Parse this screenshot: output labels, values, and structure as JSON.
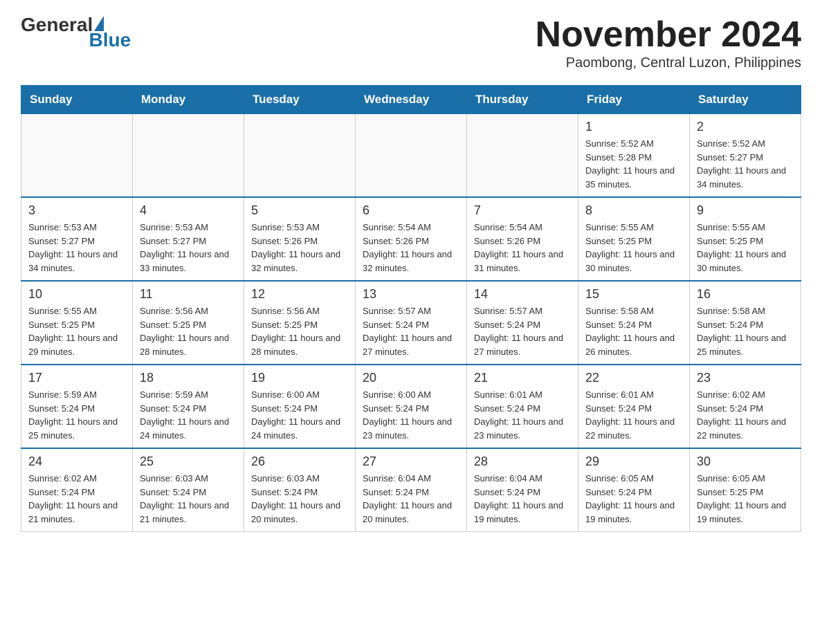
{
  "header": {
    "logo": {
      "general": "General",
      "blue": "Blue"
    },
    "title": "November 2024",
    "location": "Paombong, Central Luzon, Philippines"
  },
  "days_of_week": [
    "Sunday",
    "Monday",
    "Tuesday",
    "Wednesday",
    "Thursday",
    "Friday",
    "Saturday"
  ],
  "weeks": [
    [
      {
        "day": "",
        "sunrise": "",
        "sunset": "",
        "daylight": ""
      },
      {
        "day": "",
        "sunrise": "",
        "sunset": "",
        "daylight": ""
      },
      {
        "day": "",
        "sunrise": "",
        "sunset": "",
        "daylight": ""
      },
      {
        "day": "",
        "sunrise": "",
        "sunset": "",
        "daylight": ""
      },
      {
        "day": "",
        "sunrise": "",
        "sunset": "",
        "daylight": ""
      },
      {
        "day": "1",
        "sunrise": "Sunrise: 5:52 AM",
        "sunset": "Sunset: 5:28 PM",
        "daylight": "Daylight: 11 hours and 35 minutes."
      },
      {
        "day": "2",
        "sunrise": "Sunrise: 5:52 AM",
        "sunset": "Sunset: 5:27 PM",
        "daylight": "Daylight: 11 hours and 34 minutes."
      }
    ],
    [
      {
        "day": "3",
        "sunrise": "Sunrise: 5:53 AM",
        "sunset": "Sunset: 5:27 PM",
        "daylight": "Daylight: 11 hours and 34 minutes."
      },
      {
        "day": "4",
        "sunrise": "Sunrise: 5:53 AM",
        "sunset": "Sunset: 5:27 PM",
        "daylight": "Daylight: 11 hours and 33 minutes."
      },
      {
        "day": "5",
        "sunrise": "Sunrise: 5:53 AM",
        "sunset": "Sunset: 5:26 PM",
        "daylight": "Daylight: 11 hours and 32 minutes."
      },
      {
        "day": "6",
        "sunrise": "Sunrise: 5:54 AM",
        "sunset": "Sunset: 5:26 PM",
        "daylight": "Daylight: 11 hours and 32 minutes."
      },
      {
        "day": "7",
        "sunrise": "Sunrise: 5:54 AM",
        "sunset": "Sunset: 5:26 PM",
        "daylight": "Daylight: 11 hours and 31 minutes."
      },
      {
        "day": "8",
        "sunrise": "Sunrise: 5:55 AM",
        "sunset": "Sunset: 5:25 PM",
        "daylight": "Daylight: 11 hours and 30 minutes."
      },
      {
        "day": "9",
        "sunrise": "Sunrise: 5:55 AM",
        "sunset": "Sunset: 5:25 PM",
        "daylight": "Daylight: 11 hours and 30 minutes."
      }
    ],
    [
      {
        "day": "10",
        "sunrise": "Sunrise: 5:55 AM",
        "sunset": "Sunset: 5:25 PM",
        "daylight": "Daylight: 11 hours and 29 minutes."
      },
      {
        "day": "11",
        "sunrise": "Sunrise: 5:56 AM",
        "sunset": "Sunset: 5:25 PM",
        "daylight": "Daylight: 11 hours and 28 minutes."
      },
      {
        "day": "12",
        "sunrise": "Sunrise: 5:56 AM",
        "sunset": "Sunset: 5:25 PM",
        "daylight": "Daylight: 11 hours and 28 minutes."
      },
      {
        "day": "13",
        "sunrise": "Sunrise: 5:57 AM",
        "sunset": "Sunset: 5:24 PM",
        "daylight": "Daylight: 11 hours and 27 minutes."
      },
      {
        "day": "14",
        "sunrise": "Sunrise: 5:57 AM",
        "sunset": "Sunset: 5:24 PM",
        "daylight": "Daylight: 11 hours and 27 minutes."
      },
      {
        "day": "15",
        "sunrise": "Sunrise: 5:58 AM",
        "sunset": "Sunset: 5:24 PM",
        "daylight": "Daylight: 11 hours and 26 minutes."
      },
      {
        "day": "16",
        "sunrise": "Sunrise: 5:58 AM",
        "sunset": "Sunset: 5:24 PM",
        "daylight": "Daylight: 11 hours and 25 minutes."
      }
    ],
    [
      {
        "day": "17",
        "sunrise": "Sunrise: 5:59 AM",
        "sunset": "Sunset: 5:24 PM",
        "daylight": "Daylight: 11 hours and 25 minutes."
      },
      {
        "day": "18",
        "sunrise": "Sunrise: 5:59 AM",
        "sunset": "Sunset: 5:24 PM",
        "daylight": "Daylight: 11 hours and 24 minutes."
      },
      {
        "day": "19",
        "sunrise": "Sunrise: 6:00 AM",
        "sunset": "Sunset: 5:24 PM",
        "daylight": "Daylight: 11 hours and 24 minutes."
      },
      {
        "day": "20",
        "sunrise": "Sunrise: 6:00 AM",
        "sunset": "Sunset: 5:24 PM",
        "daylight": "Daylight: 11 hours and 23 minutes."
      },
      {
        "day": "21",
        "sunrise": "Sunrise: 6:01 AM",
        "sunset": "Sunset: 5:24 PM",
        "daylight": "Daylight: 11 hours and 23 minutes."
      },
      {
        "day": "22",
        "sunrise": "Sunrise: 6:01 AM",
        "sunset": "Sunset: 5:24 PM",
        "daylight": "Daylight: 11 hours and 22 minutes."
      },
      {
        "day": "23",
        "sunrise": "Sunrise: 6:02 AM",
        "sunset": "Sunset: 5:24 PM",
        "daylight": "Daylight: 11 hours and 22 minutes."
      }
    ],
    [
      {
        "day": "24",
        "sunrise": "Sunrise: 6:02 AM",
        "sunset": "Sunset: 5:24 PM",
        "daylight": "Daylight: 11 hours and 21 minutes."
      },
      {
        "day": "25",
        "sunrise": "Sunrise: 6:03 AM",
        "sunset": "Sunset: 5:24 PM",
        "daylight": "Daylight: 11 hours and 21 minutes."
      },
      {
        "day": "26",
        "sunrise": "Sunrise: 6:03 AM",
        "sunset": "Sunset: 5:24 PM",
        "daylight": "Daylight: 11 hours and 20 minutes."
      },
      {
        "day": "27",
        "sunrise": "Sunrise: 6:04 AM",
        "sunset": "Sunset: 5:24 PM",
        "daylight": "Daylight: 11 hours and 20 minutes."
      },
      {
        "day": "28",
        "sunrise": "Sunrise: 6:04 AM",
        "sunset": "Sunset: 5:24 PM",
        "daylight": "Daylight: 11 hours and 19 minutes."
      },
      {
        "day": "29",
        "sunrise": "Sunrise: 6:05 AM",
        "sunset": "Sunset: 5:24 PM",
        "daylight": "Daylight: 11 hours and 19 minutes."
      },
      {
        "day": "30",
        "sunrise": "Sunrise: 6:05 AM",
        "sunset": "Sunset: 5:25 PM",
        "daylight": "Daylight: 11 hours and 19 minutes."
      }
    ]
  ]
}
